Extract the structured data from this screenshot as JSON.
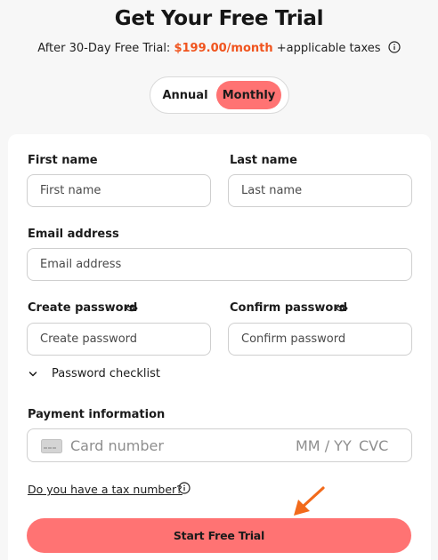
{
  "header": {
    "title": "Get Your Free Trial",
    "subtitle_prefix": "After 30-Day Free Trial: ",
    "price": "$199.00/month",
    "subtitle_suffix": " +applicable taxes"
  },
  "billing_toggle": {
    "annual_label": "Annual",
    "monthly_label": "Monthly",
    "selected": "Monthly"
  },
  "form": {
    "first_name": {
      "label": "First name",
      "placeholder": "First name",
      "value": ""
    },
    "last_name": {
      "label": "Last name",
      "placeholder": "Last name",
      "value": ""
    },
    "email": {
      "label": "Email address",
      "placeholder": "Email address",
      "value": ""
    },
    "create_password": {
      "label": "Create password",
      "placeholder": "Create password",
      "value": ""
    },
    "confirm_password": {
      "label": "Confirm password",
      "placeholder": "Confirm password",
      "value": ""
    },
    "password_checklist": "Password checklist",
    "payment": {
      "label": "Payment information",
      "card_placeholder": "Card number",
      "expiry_placeholder": "MM / YY",
      "cvc_placeholder": "CVC"
    },
    "tax_link": "Do you have a tax number?",
    "submit_label": "Start Free Trial"
  },
  "colors": {
    "accent": "#ff7373",
    "price": "#f0541e",
    "arrow": "#f26a1b"
  },
  "icons": {
    "info": "info-icon",
    "eye": "eye-icon",
    "chevron": "chevron-down-icon",
    "card": "credit-card-icon",
    "arrow": "pointer-arrow-icon"
  }
}
